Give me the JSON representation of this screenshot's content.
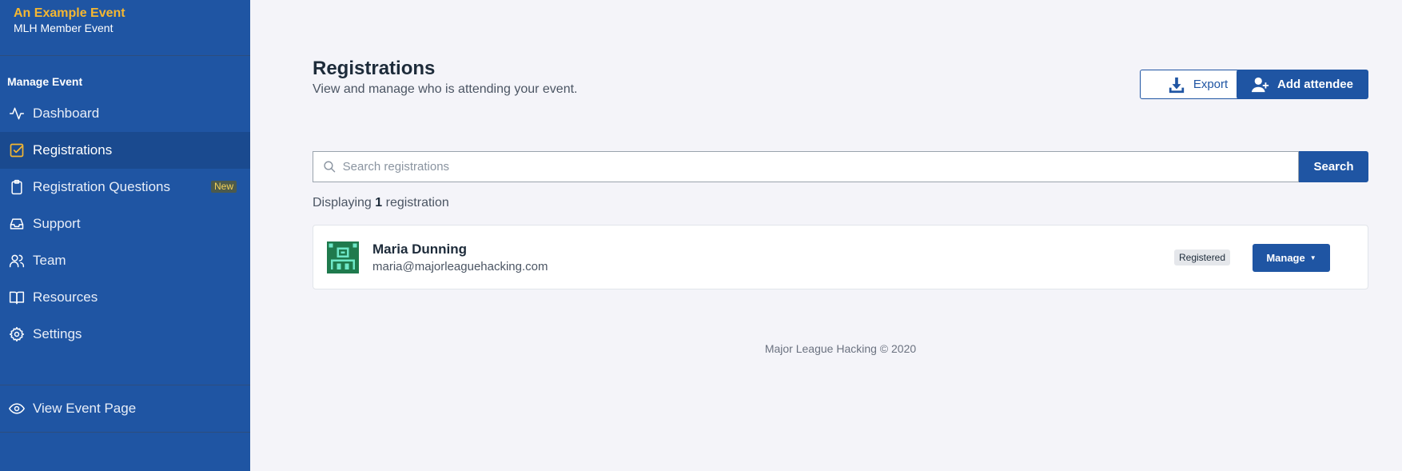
{
  "event": {
    "title": "An Example Event",
    "subtitle": "MLH Member Event"
  },
  "sidebar": {
    "section_label": "Manage Event",
    "items": [
      {
        "label": "Dashboard",
        "icon": "activity-icon"
      },
      {
        "label": "Registrations",
        "icon": "checkbox-icon",
        "active": true
      },
      {
        "label": "Registration Questions",
        "icon": "clipboard-icon",
        "badge": "New"
      },
      {
        "label": "Support",
        "icon": "inbox-icon"
      },
      {
        "label": "Team",
        "icon": "users-icon"
      },
      {
        "label": "Resources",
        "icon": "book-icon"
      },
      {
        "label": "Settings",
        "icon": "gear-icon"
      }
    ],
    "view_event_page": "View Event Page"
  },
  "header": {
    "title": "Registrations",
    "subtitle": "View and manage who is attending your event.",
    "export_label": "Export",
    "add_attendee_label": "Add attendee"
  },
  "search": {
    "placeholder": "Search registrations",
    "value": "",
    "button_label": "Search"
  },
  "results": {
    "prefix": "Displaying",
    "count": "1",
    "suffix": "registration"
  },
  "registrations": [
    {
      "name": "Maria Dunning",
      "email": "maria@majorleaguehacking.com",
      "status": "Registered",
      "action_label": "Manage"
    }
  ],
  "footer": "Major League Hacking © 2020",
  "colors": {
    "sidebar": "#1f55a3",
    "accent": "#1f55a3",
    "event_title": "#f5b731",
    "background": "#f4f4f9"
  }
}
